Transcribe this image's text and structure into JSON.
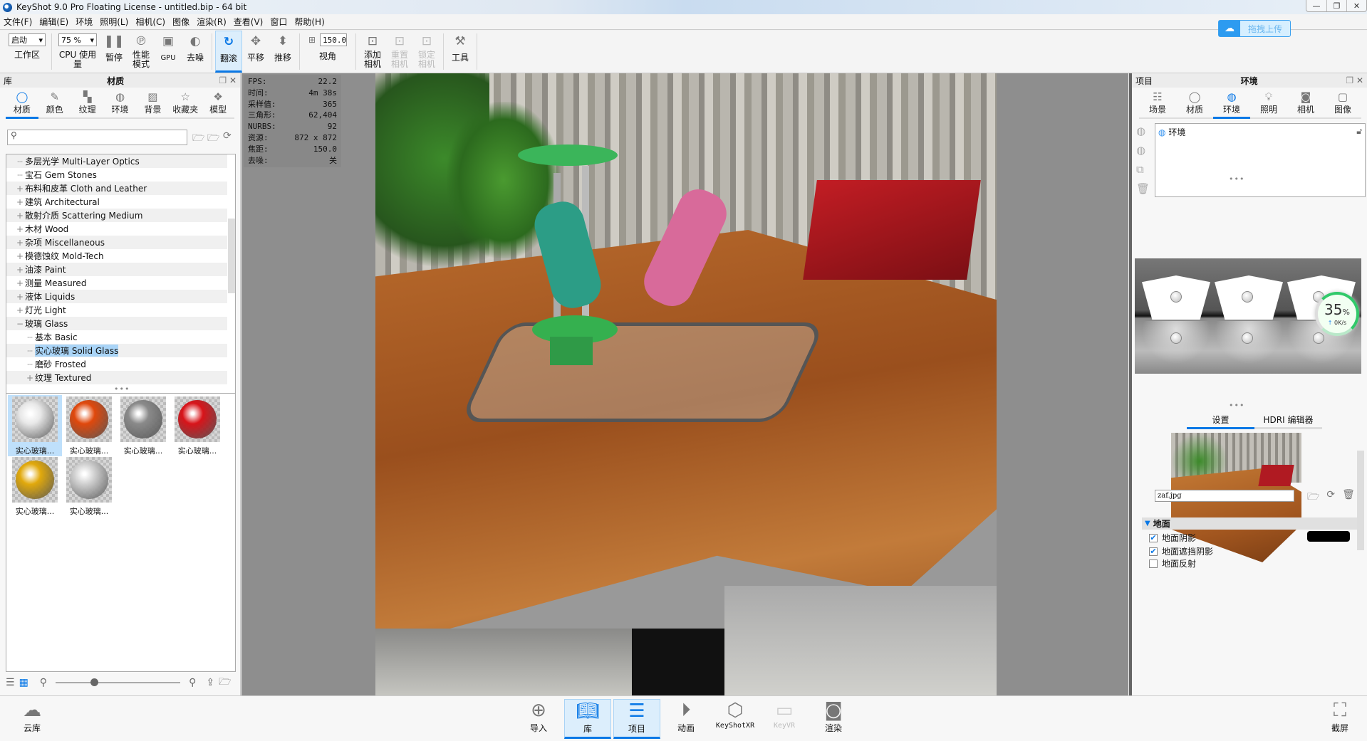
{
  "window": {
    "title": "KeyShot 9.0 Pro Floating License  - untitled.bip  - 64 bit",
    "controls": [
      "—",
      "❐",
      "✕"
    ]
  },
  "menu": [
    "文件(F)",
    "编辑(E)",
    "环境",
    "照明(L)",
    "相机(C)",
    "图像",
    "渲染(R)",
    "查看(V)",
    "窗口",
    "帮助(H)"
  ],
  "upload": {
    "label": "拖拽上传",
    "icon": "cloud-icon"
  },
  "toolbar": {
    "workspace": {
      "value": "启动",
      "label": "工作区"
    },
    "cpu": {
      "value": "75 %",
      "label": "CPU 使用量"
    },
    "pause": "暂停",
    "perf": "性能\n模式",
    "gpu": "GPU",
    "denoise": "去噪",
    "tumble": "翻滚",
    "pan": "平移",
    "dolly": "推移",
    "fov": {
      "value": "150.0",
      "label": "视角"
    },
    "add_camera": "添加\n相机",
    "reset_camera": "重置\n相机",
    "lock_camera": "锁定\n相机",
    "tools": "工具"
  },
  "library": {
    "header_left": "库",
    "header_title": "材质",
    "tabs": [
      {
        "label": "材质",
        "icon": "material-icon",
        "active": true
      },
      {
        "label": "颜色",
        "icon": "color-icon"
      },
      {
        "label": "纹理",
        "icon": "texture-icon"
      },
      {
        "label": "环境",
        "icon": "globe-icon"
      },
      {
        "label": "背景",
        "icon": "image-icon"
      },
      {
        "label": "收藏夹",
        "icon": "star-icon"
      },
      {
        "label": "模型",
        "icon": "cubes-icon"
      }
    ],
    "search_placeholder": "",
    "tree": [
      {
        "label": "多层光学 Multi-Layer Optics",
        "level": 1,
        "pm": ""
      },
      {
        "label": "宝石 Gem Stones",
        "level": 1,
        "pm": ""
      },
      {
        "label": "布料和皮革 Cloth and Leather",
        "level": 1,
        "pm": "+"
      },
      {
        "label": "建筑 Architectural",
        "level": 1,
        "pm": "+"
      },
      {
        "label": "散射介质 Scattering Medium",
        "level": 1,
        "pm": "+"
      },
      {
        "label": "木材 Wood",
        "level": 1,
        "pm": "+"
      },
      {
        "label": "杂项 Miscellaneous",
        "level": 1,
        "pm": "+"
      },
      {
        "label": "模德蚀纹 Mold-Tech",
        "level": 1,
        "pm": "+"
      },
      {
        "label": "油漆 Paint",
        "level": 1,
        "pm": "+"
      },
      {
        "label": "测量 Measured",
        "level": 1,
        "pm": "+"
      },
      {
        "label": "液体 Liquids",
        "level": 1,
        "pm": "+"
      },
      {
        "label": "灯光 Light",
        "level": 1,
        "pm": "+"
      },
      {
        "label": "玻璃 Glass",
        "level": 1,
        "pm": "−"
      },
      {
        "label": "基本 Basic",
        "level": 2,
        "pm": ""
      },
      {
        "label": "实心玻璃 Solid Glass",
        "level": 2,
        "pm": "",
        "selected": true
      },
      {
        "label": "磨砂 Frosted",
        "level": 2,
        "pm": ""
      },
      {
        "label": "纹理 Textured",
        "level": 2,
        "pm": "+"
      }
    ],
    "thumbnails": [
      {
        "label": "实心玻璃...",
        "color": "#e8e8e8",
        "selected": true
      },
      {
        "label": "实心玻璃...",
        "color": "#e0480c"
      },
      {
        "label": "实心玻璃...",
        "color": "#8a8a8a"
      },
      {
        "label": "实心玻璃...",
        "color": "#d8141a"
      },
      {
        "label": "实心玻璃...",
        "color": "#e1a90c"
      },
      {
        "label": "实心玻璃...",
        "color": "#cfcfcf"
      }
    ],
    "zoom_slider": 0.28
  },
  "stats": [
    [
      "FPS:",
      "22.2"
    ],
    [
      "时间:",
      "4m 38s"
    ],
    [
      "采样值:",
      "365"
    ],
    [
      "三角形:",
      "62,404"
    ],
    [
      "NURBS:",
      "92"
    ],
    [
      "资源:",
      "872 x 872"
    ],
    [
      "焦距:",
      "150.0"
    ],
    [
      "去噪:",
      "关"
    ]
  ],
  "project": {
    "header_left": "项目",
    "header_title": "环境",
    "tabs": [
      {
        "label": "场景",
        "icon": "list-icon"
      },
      {
        "label": "材质",
        "icon": "material-icon"
      },
      {
        "label": "环境",
        "icon": "globe-icon",
        "active": true
      },
      {
        "label": "照明",
        "icon": "bulb-icon"
      },
      {
        "label": "相机",
        "icon": "camera-icon"
      },
      {
        "label": "图像",
        "icon": "image-frame-icon"
      }
    ],
    "env_items": [
      "环境"
    ],
    "meter": {
      "percent": "35",
      "unit": "%",
      "speed": "0K/s"
    },
    "subtabs": [
      "设置",
      "HDRI 编辑器"
    ],
    "filename": "zaf.jpg",
    "ground": {
      "title": "地面",
      "shadow_color": "#000000",
      "options": [
        {
          "label": "地面阴影",
          "checked": true
        },
        {
          "label": "地面遮挡阴影",
          "checked": true
        },
        {
          "label": "地面反射",
          "checked": false
        }
      ]
    }
  },
  "bottombar": {
    "cloud": "云库",
    "items": [
      {
        "label": "导入",
        "icon": "import-icon"
      },
      {
        "label": "库",
        "icon": "book-icon",
        "active": true
      },
      {
        "label": "项目",
        "icon": "project-list-icon",
        "active": true
      },
      {
        "label": "动画",
        "icon": "animation-play-icon"
      },
      {
        "label": "KeyShotXR",
        "icon": "xr-cube-icon"
      },
      {
        "label": "KeyVR",
        "icon": "vr-headset-icon",
        "disabled": true
      },
      {
        "label": "渲染",
        "icon": "render-camera-icon"
      }
    ],
    "screenshot": "截屏"
  }
}
